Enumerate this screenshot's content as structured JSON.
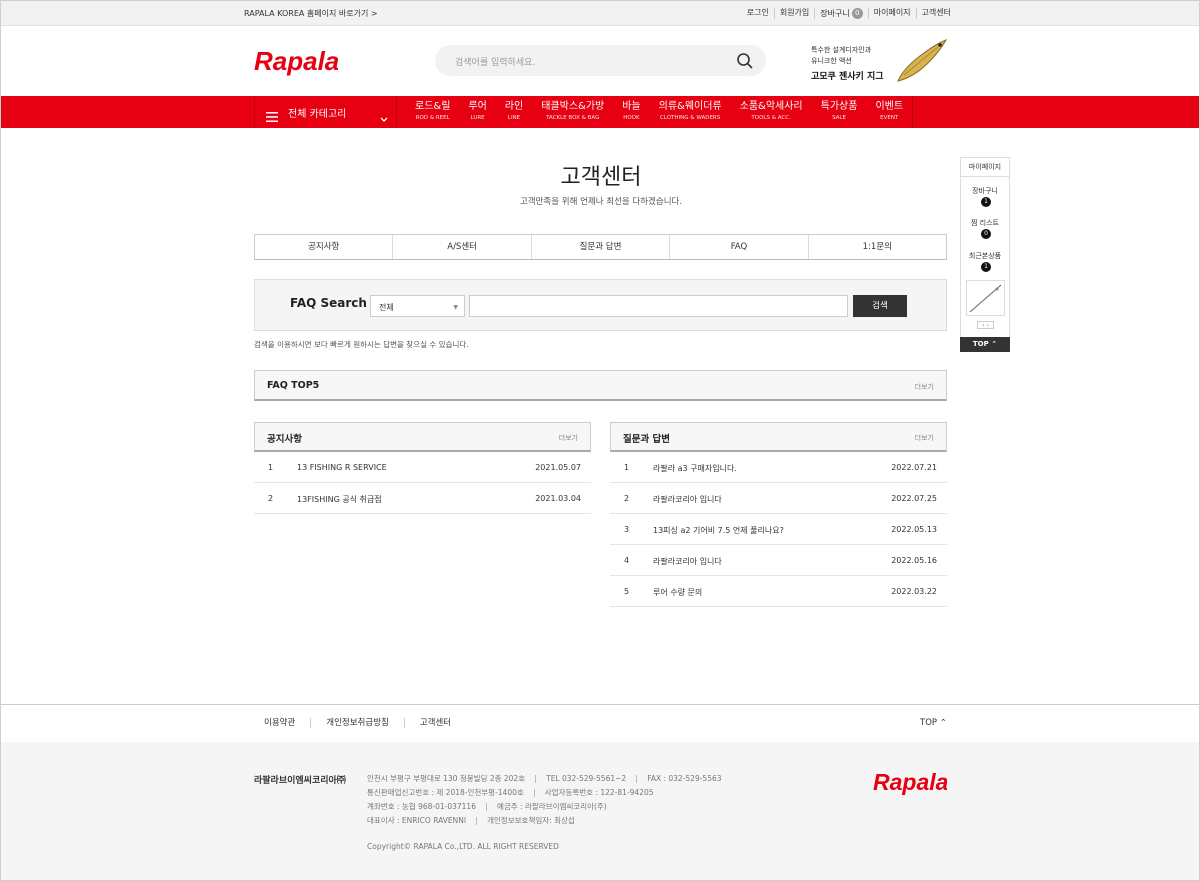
{
  "topbar": {
    "korea_link": "RAPALA KOREA 홈페이지 바로가기 >",
    "util": [
      "로그인",
      "회원가입",
      "장바구니",
      "마이페이지",
      "고객센터"
    ],
    "cart_count": "0"
  },
  "header": {
    "logo_text": "Rapala",
    "search_placeholder": "검색어를 입력하세요.",
    "promo_line1": "특수한 설계디자인과",
    "promo_line2": "유니크한 액션",
    "promo_line3": "고모쿠 젠사키 지그"
  },
  "nav": {
    "all_category": "전체 카테고리",
    "items": [
      {
        "ko": "로드&릴",
        "en": "ROD & REEL"
      },
      {
        "ko": "루어",
        "en": "LURE"
      },
      {
        "ko": "라인",
        "en": "LINE"
      },
      {
        "ko": "태클박스&가방",
        "en": "TACKLE BOX & BAG"
      },
      {
        "ko": "바늘",
        "en": "HOOK"
      },
      {
        "ko": "의류&웨이더류",
        "en": "CLOTHING & WADERS"
      },
      {
        "ko": "소품&악세사리",
        "en": "TOOLS & ACC."
      },
      {
        "ko": "특가상품",
        "en": "SALE"
      },
      {
        "ko": "이벤트",
        "en": "EVENT"
      }
    ]
  },
  "page": {
    "title": "고객센터",
    "subtitle": "고객만족을 위해 언제나 최선을 다하겠습니다.",
    "tabs": [
      "공지사항",
      "A/S센터",
      "질문과 답변",
      "FAQ",
      "1:1문의"
    ]
  },
  "faq": {
    "title": "FAQ Search",
    "select_value": "전체",
    "button": "검색",
    "hint": "검색을 이용하시면 보다 빠르게 원하시는 답변을 찾으실 수 있습니다.",
    "top5_title": "FAQ TOP5",
    "more": "더보기"
  },
  "notice": {
    "title": "공지사항",
    "more": "더보기",
    "rows": [
      {
        "n": "1",
        "t": "13 FISHING R SERVICE",
        "d": "2021.05.07"
      },
      {
        "n": "2",
        "t": "13FISHING 공식 취급점",
        "d": "2021.03.04"
      }
    ]
  },
  "qna": {
    "title": "질문과 답변",
    "more": "더보기",
    "rows": [
      {
        "n": "1",
        "t": "라팔라 a3 구매자입니다.",
        "d": "2022.07.21"
      },
      {
        "n": "2",
        "t": "라팔라코리아 입니다",
        "d": "2022.07.25"
      },
      {
        "n": "3",
        "t": "13피싱 a2 기어비 7.5 언제 풀리나요?",
        "d": "2022.05.13"
      },
      {
        "n": "4",
        "t": "라팔라코리아 입니다",
        "d": "2022.05.16"
      },
      {
        "n": "5",
        "t": "루어 수량 문의",
        "d": "2022.03.22"
      }
    ]
  },
  "quick": {
    "mypage": "마이페이지",
    "cart": "장바구니",
    "cart_count": "1",
    "wish": "찜 리스트",
    "wish_count": "0",
    "recent": "최근본상품",
    "recent_count": "1",
    "top": "TOP"
  },
  "footer": {
    "links": [
      "이용약관",
      "개인정보취급방침",
      "고객센터"
    ],
    "top": "TOP",
    "company": "라팔라브이엠씨코리아㈜",
    "line1": [
      "인천시 부평구 부평대로 130 청봉빌딩 2층 202호",
      "TEL 032-529-5561~2",
      "FAX : 032-529-5563"
    ],
    "line2": [
      "통신판매업신고번호 : 제 2018-인천부평-1400호",
      "사업자등록번호 : 122-81-94205"
    ],
    "line3": [
      "계좌번호 : 농협 968-01-037116",
      "예금주 : 라팔라브이엠씨코리아(주)"
    ],
    "line4": [
      "대표이사 : ENRICO RAVENNI",
      "개인정보보호책임자: 최상섭"
    ],
    "copyright": "Copyright© RAPALA Co.,LTD. ALL RIGHT RESERVED"
  },
  "colors": {
    "brand_red": "#e60012",
    "dark": "#333333"
  }
}
